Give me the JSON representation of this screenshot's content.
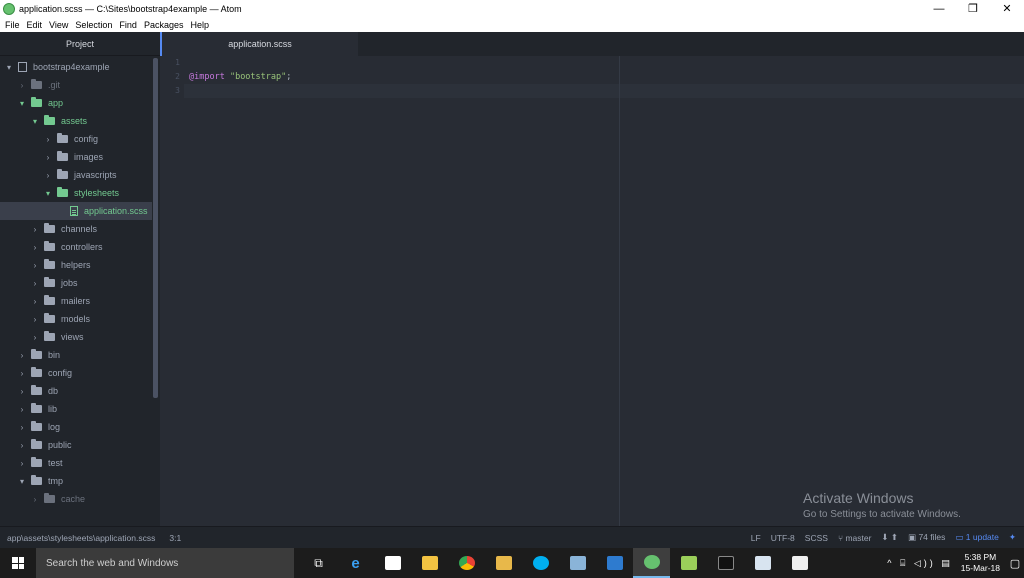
{
  "window": {
    "title": "application.scss — C:\\Sites\\bootstrap4example — Atom",
    "minimize": "—",
    "maximize": "❐",
    "close": "✕"
  },
  "menu": [
    "File",
    "Edit",
    "View",
    "Selection",
    "Find",
    "Packages",
    "Help"
  ],
  "tree": {
    "header": "Project",
    "items": [
      {
        "label": "bootstrap4example",
        "depth": 0,
        "chevron": "▾",
        "icon": "repo",
        "style": ""
      },
      {
        "label": ".git",
        "depth": 1,
        "chevron": "›",
        "icon": "folder",
        "style": "dim"
      },
      {
        "label": "app",
        "depth": 1,
        "chevron": "▾",
        "icon": "folder",
        "style": "green"
      },
      {
        "label": "assets",
        "depth": 2,
        "chevron": "▾",
        "icon": "folder",
        "style": "green"
      },
      {
        "label": "config",
        "depth": 3,
        "chevron": "›",
        "icon": "folder",
        "style": ""
      },
      {
        "label": "images",
        "depth": 3,
        "chevron": "›",
        "icon": "folder",
        "style": ""
      },
      {
        "label": "javascripts",
        "depth": 3,
        "chevron": "›",
        "icon": "folder",
        "style": ""
      },
      {
        "label": "stylesheets",
        "depth": 3,
        "chevron": "▾",
        "icon": "folder",
        "style": "green"
      },
      {
        "label": "application.scss",
        "depth": 4,
        "chevron": "",
        "icon": "file",
        "style": "green selected"
      },
      {
        "label": "channels",
        "depth": 2,
        "chevron": "›",
        "icon": "folder",
        "style": ""
      },
      {
        "label": "controllers",
        "depth": 2,
        "chevron": "›",
        "icon": "folder",
        "style": ""
      },
      {
        "label": "helpers",
        "depth": 2,
        "chevron": "›",
        "icon": "folder",
        "style": ""
      },
      {
        "label": "jobs",
        "depth": 2,
        "chevron": "›",
        "icon": "folder",
        "style": ""
      },
      {
        "label": "mailers",
        "depth": 2,
        "chevron": "›",
        "icon": "folder",
        "style": ""
      },
      {
        "label": "models",
        "depth": 2,
        "chevron": "›",
        "icon": "folder",
        "style": ""
      },
      {
        "label": "views",
        "depth": 2,
        "chevron": "›",
        "icon": "folder",
        "style": ""
      },
      {
        "label": "bin",
        "depth": 1,
        "chevron": "›",
        "icon": "folder",
        "style": ""
      },
      {
        "label": "config",
        "depth": 1,
        "chevron": "›",
        "icon": "folder",
        "style": ""
      },
      {
        "label": "db",
        "depth": 1,
        "chevron": "›",
        "icon": "folder",
        "style": ""
      },
      {
        "label": "lib",
        "depth": 1,
        "chevron": "›",
        "icon": "folder",
        "style": ""
      },
      {
        "label": "log",
        "depth": 1,
        "chevron": "›",
        "icon": "folder",
        "style": ""
      },
      {
        "label": "public",
        "depth": 1,
        "chevron": "›",
        "icon": "folder",
        "style": ""
      },
      {
        "label": "test",
        "depth": 1,
        "chevron": "›",
        "icon": "folder",
        "style": ""
      },
      {
        "label": "tmp",
        "depth": 1,
        "chevron": "▾",
        "icon": "folder",
        "style": ""
      },
      {
        "label": "cache",
        "depth": 2,
        "chevron": "›",
        "icon": "folder",
        "style": "dim"
      }
    ]
  },
  "tab": {
    "label": "application.scss"
  },
  "editor": {
    "line_numbers": [
      "1",
      "2",
      "3"
    ],
    "code": {
      "keyword": "@import",
      "string": "\"bootstrap\"",
      "punct": ";"
    }
  },
  "watermark": {
    "title": "Activate Windows",
    "subtitle": "Go to Settings to activate Windows."
  },
  "status": {
    "path": "app\\assets\\stylesheets\\application.scss",
    "cursor": "3:1",
    "line_ending": "LF",
    "encoding": "UTF-8",
    "grammar": "SCSS",
    "branch": "master",
    "files": "74 files",
    "update": "1 update"
  },
  "taskbar": {
    "search_placeholder": "Search the web and Windows",
    "time": "5:38 PM",
    "date": "15-Mar-18"
  },
  "colors": {
    "accent": "#568af2",
    "git_green": "#73c990",
    "keyword": "#c678dd",
    "string": "#98c379"
  }
}
